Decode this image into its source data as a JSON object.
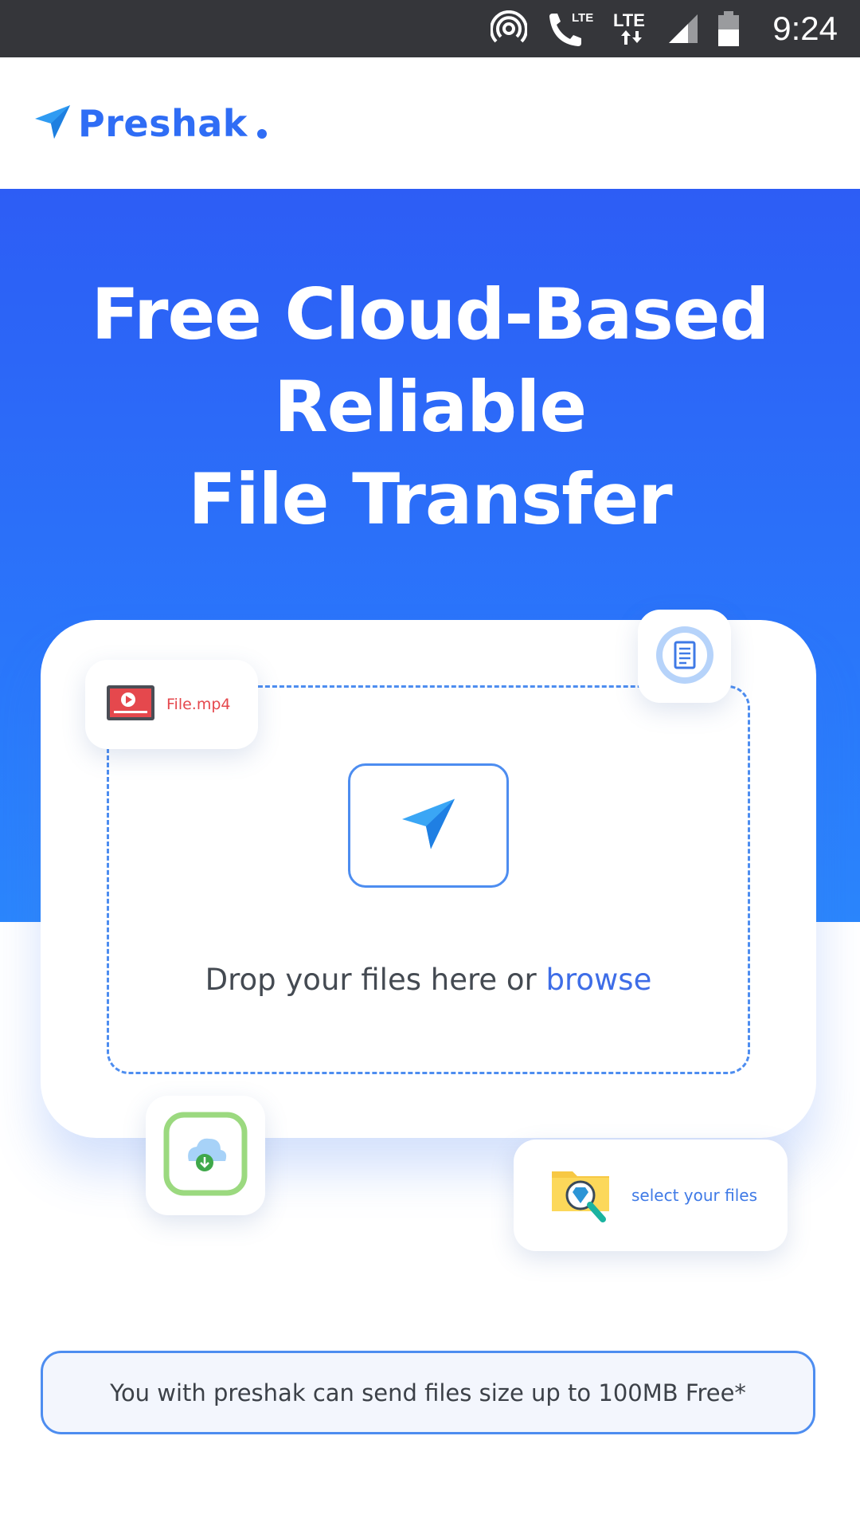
{
  "status_bar": {
    "time": "9:24",
    "lte_label_1": "LTE",
    "lte_label_2": "LTE",
    "icons": [
      "hotspot-icon",
      "wifi-calling-icon",
      "lte-data-icon",
      "signal-icon",
      "battery-icon"
    ]
  },
  "header": {
    "logo_text": "Preshak",
    "logo_icon": "paper-plane-icon",
    "brand_color": "#2f6df5"
  },
  "hero": {
    "title_line_1": "Free Cloud-Based",
    "title_line_2": "Reliable",
    "title_line_3": "File Transfer",
    "background_color": "#2d6ff8"
  },
  "upload": {
    "drop_text": "Drop your files here or",
    "browse_label": "browse",
    "send_icon": "paper-plane-icon"
  },
  "chips": {
    "file_label": "File.mp4",
    "file_icon": "video-file-icon",
    "doc_icon": "document-icon",
    "cloud_icon": "cloud-download-icon",
    "select_label": "select your files",
    "select_icon": "folder-search-icon"
  },
  "info": {
    "text": "You with preshak can send files size up to 100MB Free*"
  }
}
